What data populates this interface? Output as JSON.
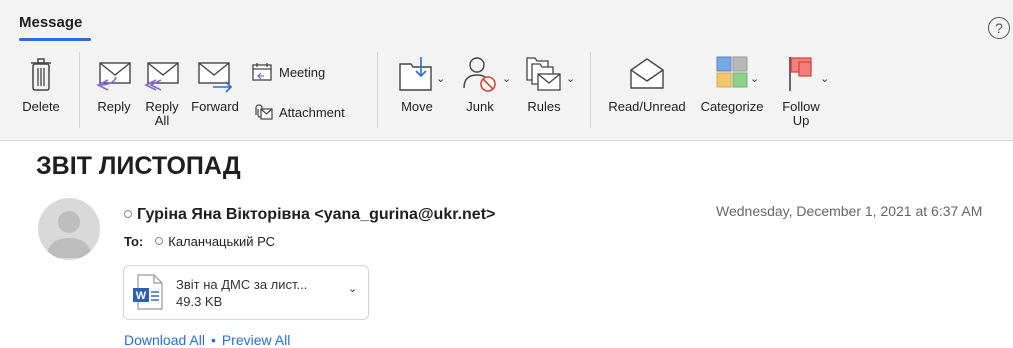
{
  "ribbon": {
    "tab_label": "Message",
    "help_glyph": "?",
    "buttons": {
      "delete": "Delete",
      "reply": "Reply",
      "reply_all_1": "Reply",
      "reply_all_2": "All",
      "forward": "Forward",
      "meeting": "Meeting",
      "attachment": "Attachment",
      "move": "Move",
      "junk": "Junk",
      "rules": "Rules",
      "read_unread": "Read/Unread",
      "categorize": "Categorize",
      "follow_up_1": "Follow",
      "follow_up_2": "Up"
    },
    "accent_color": "#2b6fd6"
  },
  "message": {
    "subject": "ЗВІТ ЛИСТОПАД",
    "sender": "Гуріна Яна Вікторівна <yana_gurina@ukr.net>",
    "date": "Wednesday, December 1, 2021 at 6:37 AM",
    "to_label": "To:",
    "to_name": "Каланчацький РС",
    "attachment": {
      "name": "Звіт на ДМС за лист...",
      "size": "49.3 KB",
      "icon": "word-doc-icon"
    },
    "download_all": "Download All",
    "link_separator": "•",
    "preview_all": "Preview All"
  }
}
